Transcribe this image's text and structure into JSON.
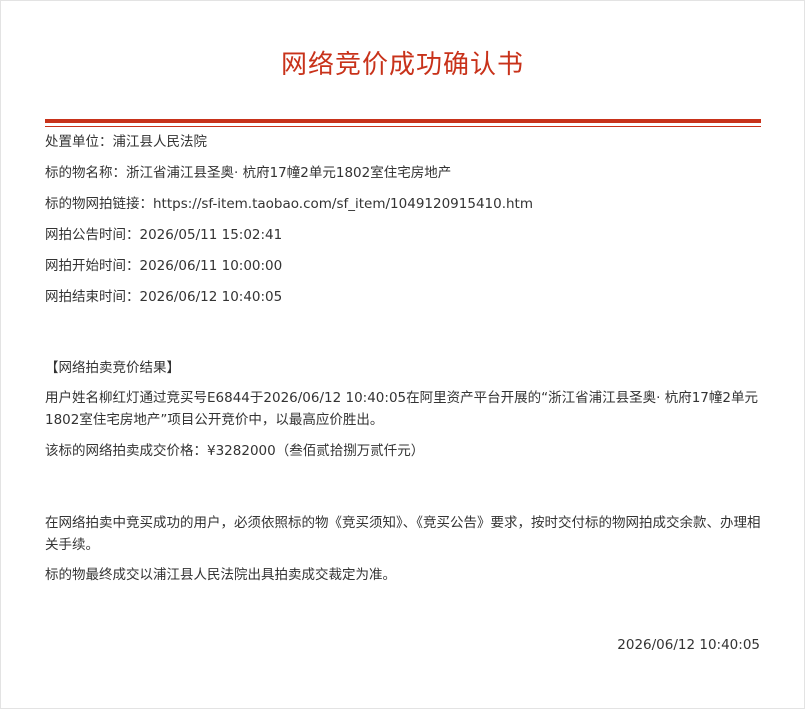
{
  "document": {
    "title": "网络竞价成功确认书",
    "fields": [
      {
        "label": "处置单位：",
        "value": "浦江县人民法院"
      },
      {
        "label": "标的物名称：",
        "value": "浙江省浦江县圣奥· 杭府17幢2单元1802室住宅房地产"
      },
      {
        "label": "标的物网拍链接：",
        "value": "https://sf-item.taobao.com/sf_item/1049120915410.htm"
      },
      {
        "label": "网拍公告时间：",
        "value": "2026/05/11 15:02:41"
      },
      {
        "label": "网拍开始时间：",
        "value": "2026/06/11 10:00:00"
      },
      {
        "label": "网拍结束时间：",
        "value": "2026/06/12 10:40:05"
      }
    ],
    "result_heading": "【网络拍卖竞价结果】",
    "result_text": "用户姓名柳红灯通过竞买号E6844于2026/06/12 10:40:05在阿里资产平台开展的“浙江省浦江县圣奥· 杭府17幢2单元1802室住宅房地产”项目公开竞价中，以最高应价胜出。",
    "price_line": "该标的网络拍卖成交价格：¥3282000（叁佰贰拾捌万贰仟元）",
    "notice_text": "在网络拍卖中竞买成功的用户，必须依照标的物《竞买须知》、《竞买公告》要求，按时交付标的物网拍成交余款、办理相关手续。",
    "final_text": "标的物最终成交以浦江县人民法院出具拍卖成交裁定为准。",
    "timestamp": "2026/06/12 10:40:05"
  },
  "colors": {
    "accent": "#c8321a",
    "text": "#333333",
    "border": "#e3e3e3"
  }
}
